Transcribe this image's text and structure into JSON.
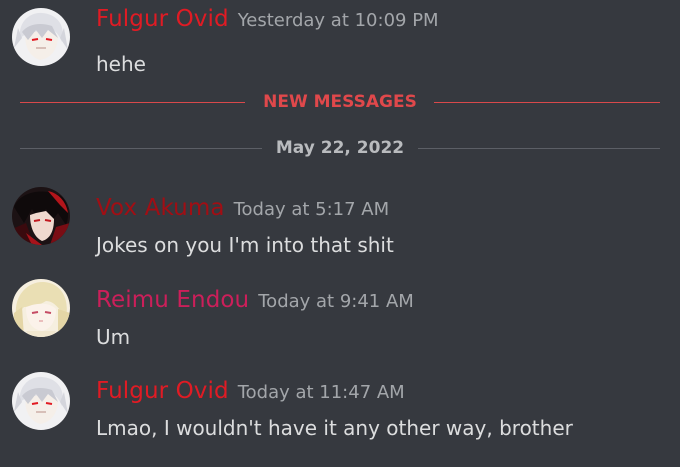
{
  "colors": {
    "background": "#36393f",
    "red_name": "#e01b24",
    "dark_red_name": "#a10e14",
    "pink_name": "#cc1f5a",
    "new_messages": "#e0484b",
    "timestamp": "#a3a6aa",
    "message_text": "#dcddde"
  },
  "messages": [
    {
      "author": "Fulgur Ovid",
      "timestamp": "Yesterday at 10:09 PM",
      "text": "hehe",
      "avatar_icon": "fulgur-ovid-avatar"
    },
    {
      "author": "Vox Akuma",
      "timestamp": "Today at 5:17 AM",
      "text": "Jokes on you I'm into that shit",
      "avatar_icon": "vox-akuma-avatar"
    },
    {
      "author": "Reimu Endou",
      "timestamp": "Today at 9:41 AM",
      "text": "Um",
      "avatar_icon": "reimu-endou-avatar"
    },
    {
      "author": "Fulgur Ovid",
      "timestamp": "Today at 11:47 AM",
      "text": "Lmao, I wouldn't have it any other way, brother",
      "avatar_icon": "fulgur-ovid-avatar"
    }
  ],
  "dividers": {
    "new_messages": "NEW MESSAGES",
    "date": "May 22, 2022"
  }
}
